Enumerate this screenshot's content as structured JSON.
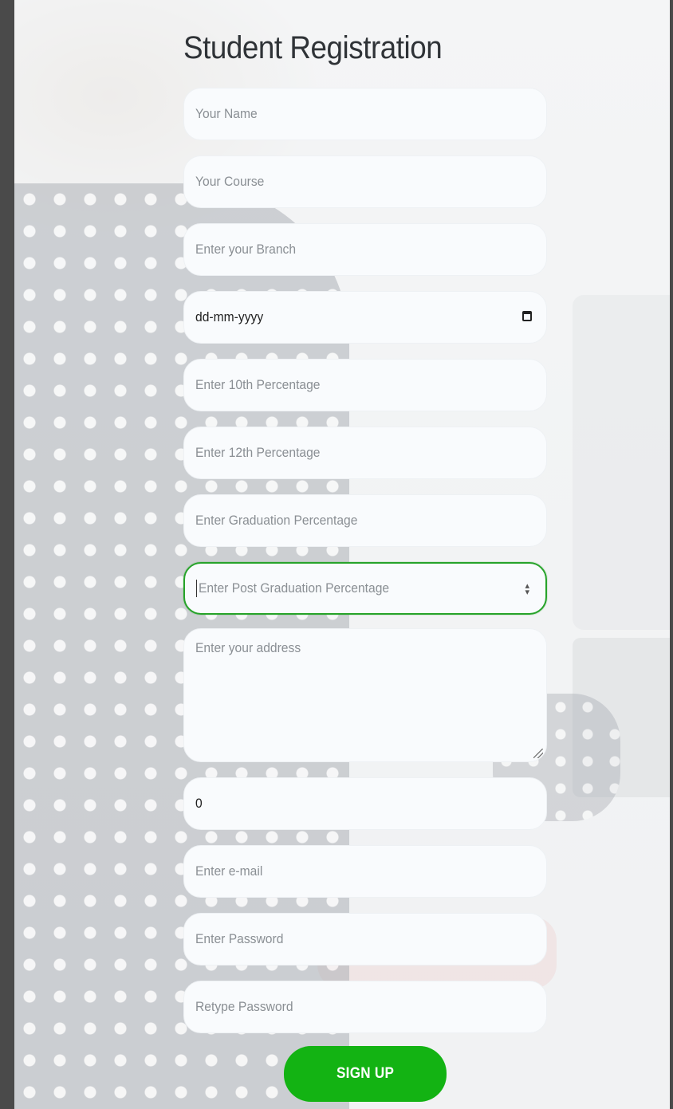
{
  "form": {
    "title": "Student Registration",
    "fields": {
      "name": {
        "placeholder": "Your Name"
      },
      "course": {
        "placeholder": "Your Course"
      },
      "branch": {
        "placeholder": "Enter your Branch"
      },
      "dob": {
        "value": "dd-mm-yyyy",
        "icon": "calendar-icon"
      },
      "tenth": {
        "placeholder": "Enter 10th Percentage"
      },
      "twelfth": {
        "placeholder": "Enter 12th Percentage"
      },
      "graduation": {
        "placeholder": "Enter Graduation Percentage"
      },
      "post_graduation": {
        "placeholder": "Enter Post Graduation Percentage",
        "icon": "spinner-arrows-icon"
      },
      "address": {
        "placeholder": "Enter your address"
      },
      "phone": {
        "value": "0"
      },
      "email": {
        "placeholder": "Enter e-mail"
      },
      "password": {
        "placeholder": "Enter Password"
      },
      "retype_password": {
        "placeholder": "Retype Password"
      }
    },
    "submit_label": "SIGN UP"
  },
  "colors": {
    "accent": "#13b313",
    "focus_border": "#27a32a",
    "title": "#2f3337"
  }
}
